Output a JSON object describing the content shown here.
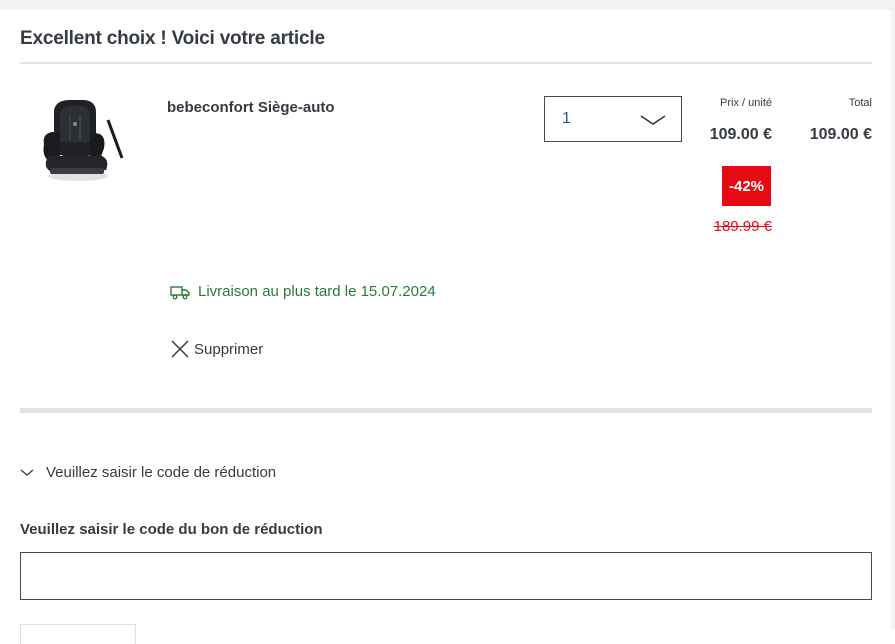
{
  "cart": {
    "heading": "Excellent choix ! Voici votre article",
    "item": {
      "name": "bebeconfort Siège-auto",
      "image_icon": "car-seat-image",
      "quantity": "1",
      "unit_price_label": "Prix / unité",
      "total_label": "Total",
      "unit_price": "109.00 €",
      "total_price": "109.00 €",
      "discount": "-42%",
      "old_price": "189.99 €",
      "delivery_text": "Livraison au plus tard le 15.07.2024",
      "delivery_icon": "truck-icon",
      "remove_label": "Supprimer",
      "remove_icon": "close-icon"
    }
  },
  "coupon": {
    "toggle_label": "Veuillez saisir le code de réduction",
    "toggle_icon": "chevron-down-icon",
    "field_label": "Veuillez saisir le code du bon de réduction",
    "field_value": "",
    "field_placeholder": ""
  },
  "colors": {
    "text": "#353b42",
    "accent_blue": "#1a5aa6",
    "discount_red": "#e60a14",
    "delivery_green": "#2b7a3a",
    "divider": "#e3e3e3"
  }
}
